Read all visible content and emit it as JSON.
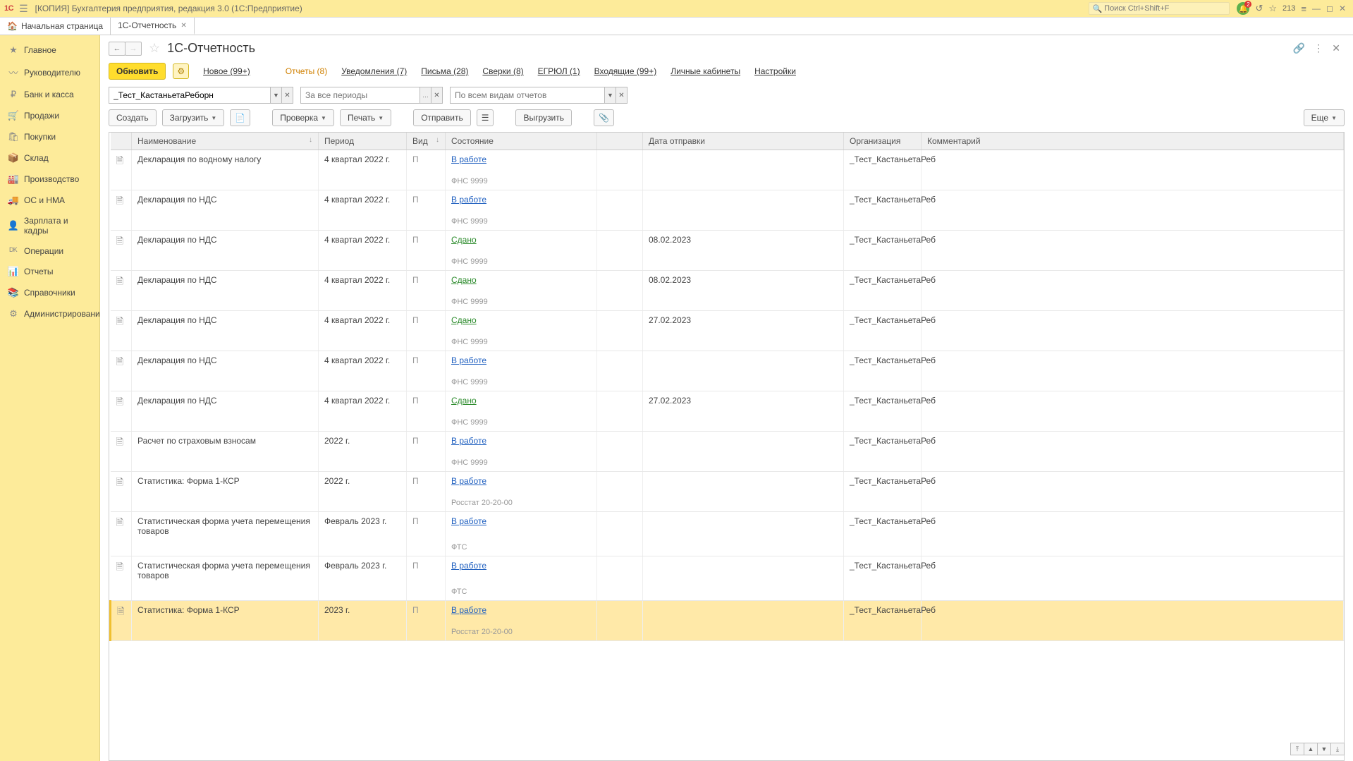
{
  "topbar": {
    "logo": "1C",
    "title": "[КОПИЯ] Бухгалтерия предприятия, редакция 3.0  (1С:Предприятие)",
    "search_placeholder": "Поиск Ctrl+Shift+F",
    "bell_badge": "2",
    "count": "213"
  },
  "tabs": {
    "home": "Начальная страница",
    "t1": "1С-Отчетность"
  },
  "sidebar": {
    "items": [
      {
        "icon": "★",
        "label": "Главное"
      },
      {
        "icon": "〰",
        "label": "Руководителю"
      },
      {
        "icon": "₽",
        "label": "Банк и касса"
      },
      {
        "icon": "🛒",
        "label": "Продажи"
      },
      {
        "icon": "🛍",
        "label": "Покупки"
      },
      {
        "icon": "📦",
        "label": "Склад"
      },
      {
        "icon": "🏭",
        "label": "Производство"
      },
      {
        "icon": "🚚",
        "label": "ОС и НМА"
      },
      {
        "icon": "👤",
        "label": "Зарплата и кадры"
      },
      {
        "icon": "ᴰᴷ",
        "label": "Операции"
      },
      {
        "icon": "📊",
        "label": "Отчеты"
      },
      {
        "icon": "📚",
        "label": "Справочники"
      },
      {
        "icon": "⚙",
        "label": "Администрирование"
      }
    ]
  },
  "page": {
    "title": "1С-Отчетность"
  },
  "links": {
    "refresh": "Обновить",
    "new": "Новое (99+)",
    "reports": "Отчеты (8)",
    "notifications": "Уведомления (7)",
    "letters": "Письма (28)",
    "sverki": "Сверки (8)",
    "egrul": "ЕГРЮЛ (1)",
    "incoming": "Входящие (99+)",
    "cabinets": "Личные кабинеты",
    "settings": "Настройки"
  },
  "filters": {
    "org": "_Тест_КастаньетаРеборн",
    "period_placeholder": "За все периоды",
    "type_placeholder": "По всем видам отчетов"
  },
  "toolbar": {
    "create": "Создать",
    "load": "Загрузить",
    "check": "Проверка",
    "print": "Печать",
    "send": "Отправить",
    "export": "Выгрузить",
    "more": "Еще"
  },
  "columns": {
    "name": "Наименование",
    "period": "Период",
    "vid": "Вид",
    "status": "Состояние",
    "date": "Дата отправки",
    "org": "Организация",
    "comment": "Комментарий"
  },
  "rows": [
    {
      "name": "Декларация по водному налогу",
      "period": "4 квартал 2022 г.",
      "vid": "П",
      "status": "В работе",
      "status_cls": "work",
      "sub": "ФНС 9999",
      "date": "",
      "org": "_Тест_КастаньетаРеб"
    },
    {
      "name": "Декларация по НДС",
      "period": "4 квартал 2022 г.",
      "vid": "П",
      "status": "В работе",
      "status_cls": "work",
      "sub": "ФНС 9999",
      "date": "",
      "org": "_Тест_КастаньетаРеб"
    },
    {
      "name": "Декларация по НДС",
      "period": "4 квартал 2022 г.",
      "vid": "П",
      "status": "Сдано",
      "status_cls": "done",
      "sub": "ФНС 9999",
      "date": "08.02.2023",
      "org": "_Тест_КастаньетаРеб"
    },
    {
      "name": "Декларация по НДС",
      "period": "4 квартал 2022 г.",
      "vid": "П",
      "status": "Сдано",
      "status_cls": "done",
      "sub": "ФНС 9999",
      "date": "08.02.2023",
      "org": "_Тест_КастаньетаРеб"
    },
    {
      "name": "Декларация по НДС",
      "period": "4 квартал 2022 г.",
      "vid": "П",
      "status": "Сдано",
      "status_cls": "done",
      "sub": "ФНС 9999",
      "date": "27.02.2023",
      "org": "_Тест_КастаньетаРеб"
    },
    {
      "name": "Декларация по НДС",
      "period": "4 квартал 2022 г.",
      "vid": "П",
      "status": "В работе",
      "status_cls": "work",
      "sub": "ФНС 9999",
      "date": "",
      "org": "_Тест_КастаньетаРеб"
    },
    {
      "name": "Декларация по НДС",
      "period": "4 квартал 2022 г.",
      "vid": "П",
      "status": "Сдано",
      "status_cls": "done",
      "sub": "ФНС 9999",
      "date": "27.02.2023",
      "org": "_Тест_КастаньетаРеб"
    },
    {
      "name": "Расчет по страховым взносам",
      "period": "2022 г.",
      "vid": "П",
      "status": "В работе",
      "status_cls": "work",
      "sub": "ФНС 9999",
      "date": "",
      "org": "_Тест_КастаньетаРеб"
    },
    {
      "name": "Статистика: Форма 1-КСР",
      "period": "2022 г.",
      "vid": "П",
      "status": "В работе",
      "status_cls": "work",
      "sub": "Росстат 20-20-00",
      "date": "",
      "org": "_Тест_КастаньетаРеб"
    },
    {
      "name": "Статистическая форма учета перемещения товаров",
      "period": "Февраль 2023 г.",
      "vid": "П",
      "status": "В работе",
      "status_cls": "work",
      "sub": "ФТС",
      "date": "",
      "org": "_Тест_КастаньетаРеб"
    },
    {
      "name": "Статистическая форма учета перемещения товаров",
      "period": "Февраль 2023 г.",
      "vid": "П",
      "status": "В работе",
      "status_cls": "work",
      "sub": "ФТС",
      "date": "",
      "org": "_Тест_КастаньетаРеб"
    },
    {
      "name": "Статистика: Форма 1-КСР",
      "period": "2023 г.",
      "vid": "П",
      "status": "В работе",
      "status_cls": "work",
      "sub": "Росстат 20-20-00",
      "date": "",
      "org": "_Тест_КастаньетаРеб",
      "selected": true
    }
  ]
}
